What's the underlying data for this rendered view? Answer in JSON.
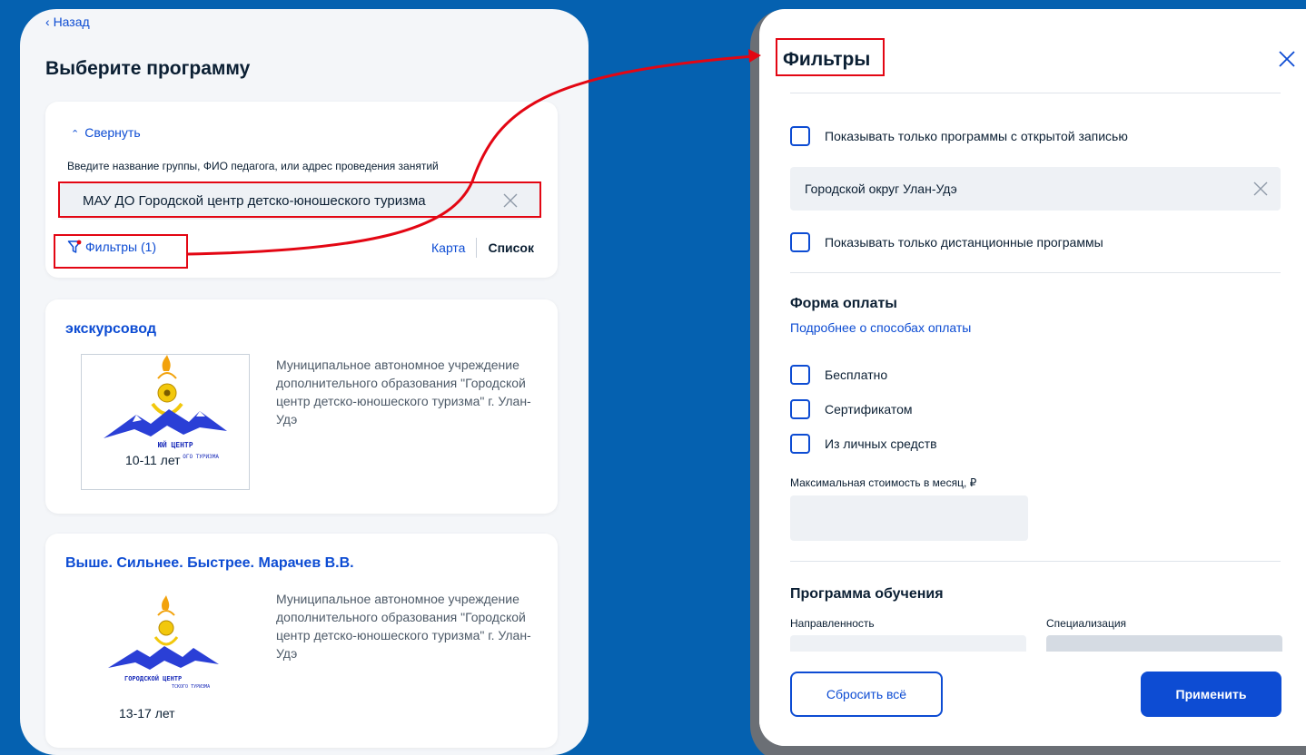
{
  "left": {
    "back_label": "Назад",
    "title": "Выберите программу",
    "search": {
      "collapse_label": "Свернуть",
      "hint": "Введите название группы, ФИО педагога, или адрес проведения занятий",
      "value": "МАУ ДО Городской центр детско-юношеского туризма",
      "filters_label": "Фильтры (1)",
      "view_map": "Карта",
      "view_list": "Список"
    },
    "results": [
      {
        "title": "экскурсовод",
        "org": "Муниципальное автономное учреждение дополнительного образования \"Городской центр детско-юношеского туризма\" г. Улан-Удэ",
        "age": "10-11 лет"
      },
      {
        "title": "Выше. Сильнее. Быстрее. Марачев В.В.",
        "org": "Муниципальное автономное учреждение дополнительного образования \"Городской центр детско-юношеского туризма\" г. Улан-Удэ",
        "age": "13-17 лет"
      }
    ]
  },
  "filters": {
    "title": "Фильтры",
    "open_only_label": "Показывать только программы с открытой записью",
    "region_value": "Городской округ Улан-Удэ",
    "remote_only_label": "Показывать только дистанционные программы",
    "payment": {
      "title": "Форма оплаты",
      "more_link": "Подробнее о способах оплаты",
      "options": [
        "Бесплатно",
        "Сертификатом",
        "Из личных средств"
      ],
      "max_cost_label": "Максимальная стоимость в месяц, ₽"
    },
    "program": {
      "title": "Программа обучения",
      "direction_label": "Направленность",
      "specialization_label": "Специализация"
    },
    "reset_label": "Сбросить всё",
    "apply_label": "Применить"
  },
  "colors": {
    "background": "#0561b0",
    "accent": "#0d4cd3",
    "highlight": "#e30613"
  }
}
